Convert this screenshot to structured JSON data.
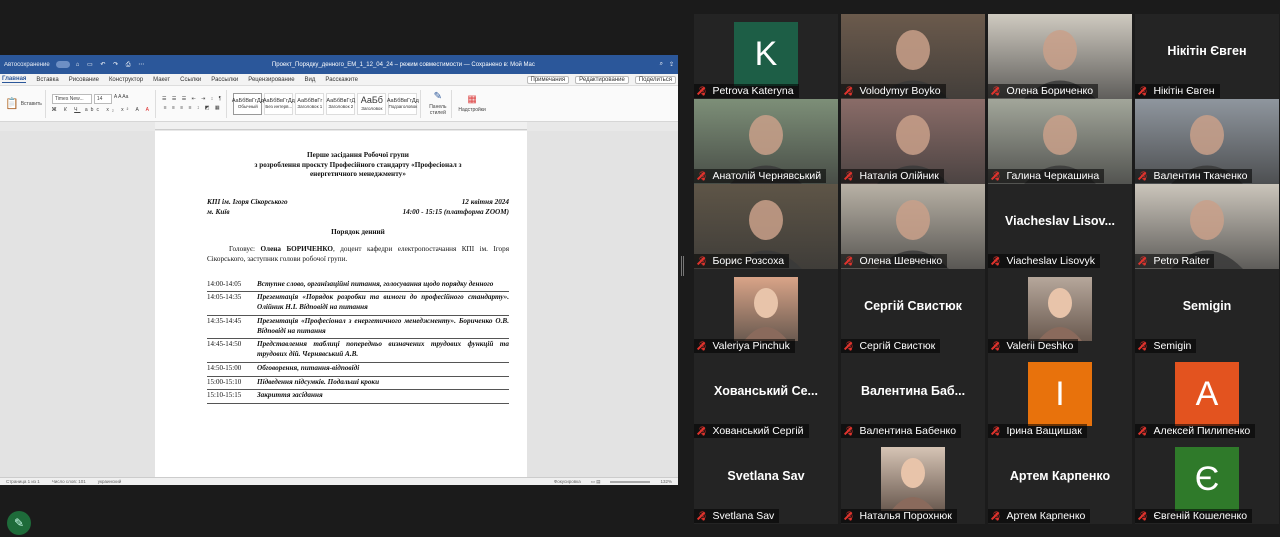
{
  "word": {
    "autosave": "Автосохранение",
    "toggle": "выкл.",
    "doc_title": "Проект_Порядку_денного_ЕМ_1_12_04_24 – режим совместимости — Сохранено в: Мой Mac",
    "tabs": [
      "Главная",
      "Вставка",
      "Рисование",
      "Конструктор",
      "Макет",
      "Ссылки",
      "Рассылки",
      "Рецензирование",
      "Вид",
      "Расскажите"
    ],
    "btn_comments": "Примечания",
    "btn_edit": "Редактирование",
    "btn_share": "Поделиться",
    "paste_label": "Вставить",
    "font_name": "Times New...",
    "font_size": "14",
    "styles": [
      {
        "preview": "АаБбВвГгДд",
        "label": "Обычный"
      },
      {
        "preview": "АаБбВвГгДд",
        "label": "Без интерв..."
      },
      {
        "preview": "АаБбВвГг",
        "label": "Заголовок 1"
      },
      {
        "preview": "АаБбВвГгД",
        "label": "Заголовок 2"
      },
      {
        "preview": "АаБб",
        "label": "Заголовок"
      },
      {
        "preview": "АаБбВвГгДд",
        "label": "Подзаголовок"
      }
    ],
    "styles_pane": "Панель стилей",
    "addins": "Надстройки",
    "status": {
      "page": "Страница 1 из 1",
      "words": "Число слов: 101",
      "lang": "украинский",
      "focus": "Фокусировка",
      "zoom": "132%"
    }
  },
  "doc": {
    "heading_1": "Перше засідання Робочої групи",
    "heading_2": "з розроблення проєкту Професійного стандарту «Професіонал з",
    "heading_3": "енергетичного менеджменту»",
    "org": "КПІ ім. Ігоря Сікорського",
    "date": "12 квітня 2024",
    "city": "м. Київ",
    "time": "14:00 - 15:15 (платформа ZOOM)",
    "agenda_title": "Порядок денний",
    "chair_label": "Головує:",
    "chair_name": "Олена БОРИЧЕНКО",
    "chair_text": ", доцент кафедри електропостачання КПІ ім. Ігоря Сікорського, заступник голови робочої групи.",
    "items": [
      {
        "time": "14:00-14:05",
        "text": "Вступне слово, організаційні питання, голосування щодо порядку денного"
      },
      {
        "time": "14:05-14:35",
        "text": "Презентація «Порядок розробки та вимоги до професійного стандарту». Олійник Н.І. Відповіді на питання"
      },
      {
        "time": "14:35-14:45",
        "text": "Презентація «Професіонал з енергетичного менеджменту». Бориченко О.В. Відповіді на питання"
      },
      {
        "time": "14:45-14:50",
        "text": "Представлення таблиці попередньо визначених трудових функцій та трудових дій. Чернявський А.В."
      },
      {
        "time": "14:50-15:00",
        "text": "Обговорення, питання-відповіді"
      },
      {
        "time": "15:00-15:10",
        "text": "Підведення підсумків. Подальші кроки"
      },
      {
        "time": "15:10-15:15",
        "text": "Закриття засідання"
      }
    ]
  },
  "participants": [
    {
      "name": "Petrova Kateryna",
      "type": "avatar",
      "initial": "K",
      "color": "#1d5e46"
    },
    {
      "name": "Volodymyr Boyko",
      "type": "video",
      "bg": "#6b5a4c"
    },
    {
      "name": "Олена Бориченко",
      "type": "video",
      "bg": "#cfcac0",
      "speaker": true
    },
    {
      "name": "Нікітін Євген",
      "type": "text",
      "big": "Нікітін Євген"
    },
    {
      "name": "Анатолій Чернявський",
      "type": "video",
      "bg": "#7d8f78"
    },
    {
      "name": "Наталія Олійник",
      "type": "video",
      "bg": "#8a6c68"
    },
    {
      "name": "Галина Черкашина",
      "type": "video",
      "bg": "#a2a69a"
    },
    {
      "name": "Валентин Ткаченко",
      "type": "video",
      "bg": "#8f969e"
    },
    {
      "name": "Борис Розсоха",
      "type": "video",
      "bg": "#5e5547"
    },
    {
      "name": "Олена Шевченко",
      "type": "video",
      "bg": "#b8b1a5"
    },
    {
      "name": "Viacheslav Lisovyk",
      "type": "text",
      "big": "Viacheslav  Lisov..."
    },
    {
      "name": "Petro Raiter",
      "type": "video",
      "bg": "#cbc5bb"
    },
    {
      "name": "Valeriya Pinchuk",
      "type": "photo",
      "bg": "#d9a488"
    },
    {
      "name": "Сергій Свистюк",
      "type": "text",
      "big": "Сергій Свистюк"
    },
    {
      "name": "Valerii Deshko",
      "type": "photo",
      "bg": "#b6a79b"
    },
    {
      "name": "Semigin",
      "type": "text",
      "big": "Semigin"
    },
    {
      "name": "Хованський Сергій",
      "type": "text",
      "big": "Хованський  Се..."
    },
    {
      "name": "Валентина Бабенко",
      "type": "text",
      "big": "Валентина  Баб..."
    },
    {
      "name": "Ірина Ващишак",
      "type": "avatar",
      "initial": "I",
      "color": "#e8720c"
    },
    {
      "name": "Алексей Пилипенко",
      "type": "avatar",
      "initial": "A",
      "color": "#e3531f"
    },
    {
      "name": "Svetlana Sav",
      "type": "text",
      "big": "Svetlana Sav"
    },
    {
      "name": "Наталья Порохнюк",
      "type": "photo",
      "bg": "#d6c4b5"
    },
    {
      "name": "Артем Карпенко",
      "type": "text",
      "big": "Артем Карпенко"
    },
    {
      "name": "Євгеній Кошеленко",
      "type": "avatar",
      "initial": "Є",
      "color": "#2f7a2a"
    }
  ]
}
